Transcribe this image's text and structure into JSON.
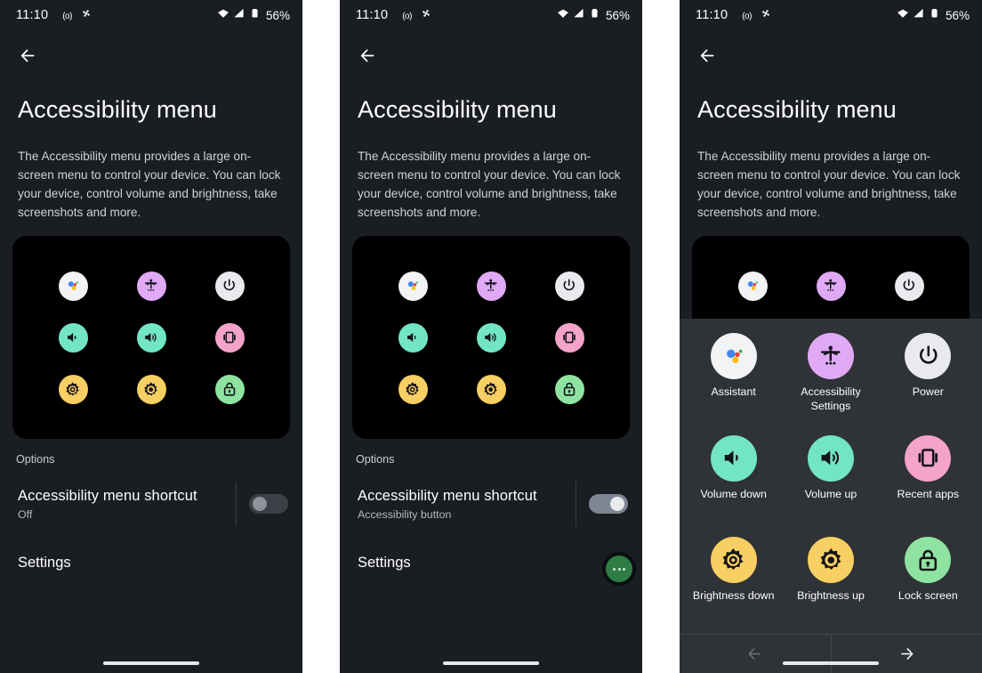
{
  "colors": {
    "screen_bg": "#1a1d21",
    "card_bg": "#000000",
    "overlay_bg": "#2f3236",
    "accent_green": "#2e7d45",
    "assistant_white": "#f1f3f4",
    "a11y_purple": "#e0a9f5",
    "power_white": "#e8eaed",
    "volume_teal": "#72e5c4",
    "recent_pink": "#f4a3cb",
    "brightness_yellow": "#f8cf62",
    "lock_green": "#8fe3a0",
    "toggle_off_track": "#3c4046",
    "toggle_on_track": "#7d8794"
  },
  "status_bar": {
    "time": "11:10",
    "left_icons": [
      "hotspot-icon",
      "pinwheel-icon"
    ],
    "right_icons": [
      "wifi-icon",
      "signal-icon",
      "battery-icon"
    ],
    "battery_percent": "56%"
  },
  "nav": {
    "back_label": "Back",
    "back_icon": "arrow-left-icon"
  },
  "page": {
    "title": "Accessibility menu",
    "description": "The Accessibility menu provides a large on-screen menu to control your device. You can lock your device, control volume and brightness, take screenshots and more."
  },
  "preview_icons": [
    {
      "name": "assistant",
      "icon": "assistant-icon",
      "color": "#f1f3f4"
    },
    {
      "name": "accessibility-settings",
      "icon": "accessibility-icon",
      "color": "#e0a9f5"
    },
    {
      "name": "power",
      "icon": "power-icon",
      "color": "#e8eaed"
    },
    {
      "name": "volume-down",
      "icon": "volume-down-icon",
      "color": "#72e5c4"
    },
    {
      "name": "volume-up",
      "icon": "volume-up-icon",
      "color": "#72e5c4"
    },
    {
      "name": "recent-apps",
      "icon": "recent-apps-icon",
      "color": "#f4a3cb"
    },
    {
      "name": "brightness-down",
      "icon": "brightness-down-icon",
      "color": "#f8cf62"
    },
    {
      "name": "brightness-up",
      "icon": "brightness-up-icon",
      "color": "#f8cf62"
    },
    {
      "name": "lock-screen",
      "icon": "lock-icon",
      "color": "#8fe3a0"
    }
  ],
  "options": {
    "header": "Options",
    "shortcut_title": "Accessibility menu shortcut",
    "shortcut_state_off": "Off",
    "shortcut_state_on": "Accessibility button",
    "settings_label": "Settings"
  },
  "fab": {
    "name": "accessibility-button",
    "icon": "three-dots-icon"
  },
  "overlay": {
    "items": [
      {
        "label": "Assistant",
        "icon": "assistant-icon",
        "color": "#f1f3f4"
      },
      {
        "label": "Accessibility Settings",
        "icon": "accessibility-icon",
        "color": "#e0a9f5"
      },
      {
        "label": "Power",
        "icon": "power-icon",
        "color": "#e8eaed"
      },
      {
        "label": "Volume down",
        "icon": "volume-down-icon",
        "color": "#72e5c4"
      },
      {
        "label": "Volume up",
        "icon": "volume-up-icon",
        "color": "#72e5c4"
      },
      {
        "label": "Recent apps",
        "icon": "recent-apps-icon",
        "color": "#f4a3cb"
      },
      {
        "label": "Brightness down",
        "icon": "brightness-down-icon",
        "color": "#f8cf62"
      },
      {
        "label": "Brightness up",
        "icon": "brightness-up-icon",
        "color": "#f8cf62"
      },
      {
        "label": "Lock screen",
        "icon": "lock-icon",
        "color": "#8fe3a0"
      }
    ],
    "prev_icon": "arrow-left-icon",
    "next_icon": "arrow-right-icon",
    "prev_enabled": false,
    "next_enabled": true
  },
  "panels": [
    {
      "id": "panel-1",
      "shortcut_on": false,
      "show_fab": false,
      "show_overlay": false
    },
    {
      "id": "panel-2",
      "shortcut_on": true,
      "show_fab": true,
      "show_overlay": false
    },
    {
      "id": "panel-3",
      "shortcut_on": true,
      "show_fab": false,
      "show_overlay": true
    }
  ]
}
